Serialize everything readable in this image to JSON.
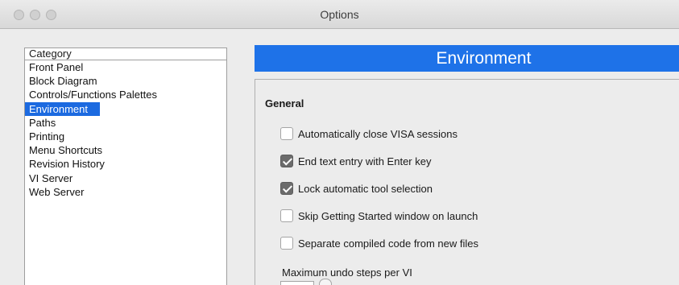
{
  "window": {
    "title": "Options"
  },
  "category": {
    "header": "Category",
    "items": [
      {
        "label": "Front Panel",
        "selected": false
      },
      {
        "label": "Block Diagram",
        "selected": false
      },
      {
        "label": "Controls/Functions Palettes",
        "selected": false
      },
      {
        "label": "Environment",
        "selected": true
      },
      {
        "label": "Paths",
        "selected": false
      },
      {
        "label": "Printing",
        "selected": false
      },
      {
        "label": "Menu Shortcuts",
        "selected": false
      },
      {
        "label": "Revision History",
        "selected": false
      },
      {
        "label": "VI Server",
        "selected": false
      },
      {
        "label": "Web Server",
        "selected": false
      }
    ]
  },
  "panel": {
    "title": "Environment",
    "section": "General",
    "options": [
      {
        "label": "Automatically close VISA sessions",
        "checked": false
      },
      {
        "label": "End text entry with Enter key",
        "checked": true
      },
      {
        "label": "Lock automatic tool selection",
        "checked": true
      },
      {
        "label": "Skip Getting Started window on launch",
        "checked": false
      },
      {
        "label": "Separate compiled code from new files",
        "checked": false
      }
    ],
    "undo_label": "Maximum undo steps per VI"
  },
  "colors": {
    "accent": "#1e72e8",
    "selection": "#1c6ae0",
    "checked": "#6b6b6b"
  },
  "icons": {
    "stepper": "stepper-arrows-icon"
  }
}
